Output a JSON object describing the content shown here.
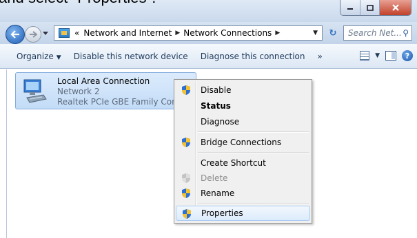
{
  "caption": "and select \"Properties\".",
  "addressbar": {
    "overflow": "«",
    "crumbs": [
      "Network and Internet",
      "Network Connections"
    ]
  },
  "search": {
    "placeholder": "Search Net..."
  },
  "toolbar": {
    "organize": "Organize",
    "disable_device": "Disable this network device",
    "diagnose_connection": "Diagnose this connection",
    "more": "»"
  },
  "connection": {
    "name": "Local Area Connection",
    "network": "Network 2",
    "adapter": "Realtek PCIe GBE Family Controlle"
  },
  "context_menu": {
    "items": [
      {
        "label": "Disable",
        "shield": true
      },
      {
        "label": "Status",
        "bold": true
      },
      {
        "label": "Diagnose"
      },
      {
        "label": "Bridge Connections",
        "shield": true
      },
      {
        "label": "Create Shortcut"
      },
      {
        "label": "Delete",
        "shield": true,
        "disabled": true
      },
      {
        "label": "Rename",
        "shield": true
      },
      {
        "label": "Properties",
        "shield": true,
        "highlighted": true
      }
    ]
  },
  "colors": {
    "shield_blue": "#2f6fd0",
    "shield_yellow": "#f2c230",
    "selection": "#c3dcf7",
    "toolbar_text": "#1e395b"
  }
}
